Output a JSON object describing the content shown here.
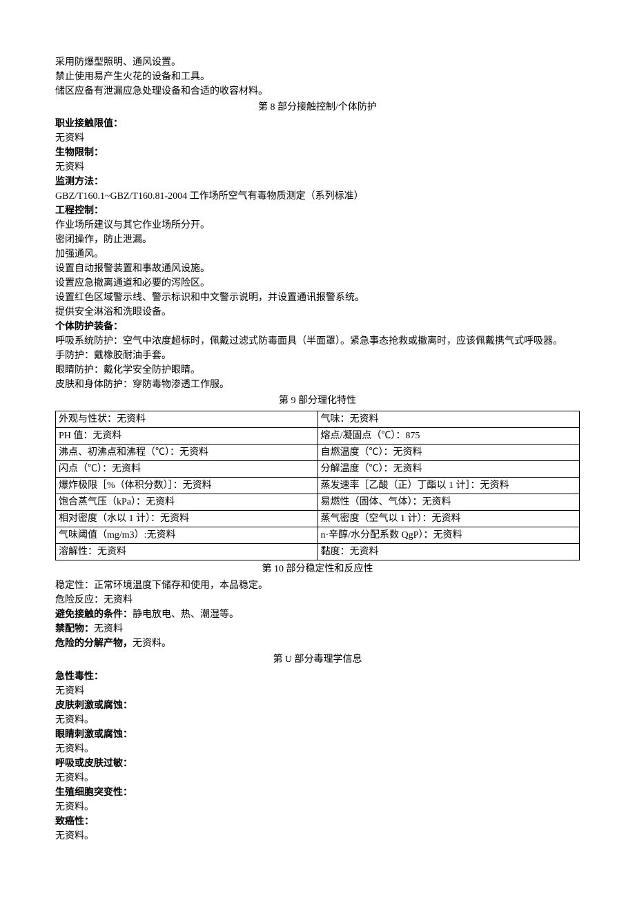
{
  "intro": {
    "line1": "采用防爆型照明、通风设置。",
    "line2": "禁止使用易产生火花的设备和工具。",
    "line3": "储区应备有泄漏应急处理设备和合适的收容材料。"
  },
  "section8": {
    "title": "第 8 部分接触控制/个体防护",
    "occupational_exposure_label": "职业接触限值：",
    "occupational_exposure_value": "无资料",
    "biological_limit_label": "生物限制：",
    "biological_limit_value": "无资料",
    "monitoring_method_label": "监测方法：",
    "monitoring_method_value": "GBZ/T160.1~GBZ/T160.81-2004 工作场所空气有毒物质测定（系列标准）",
    "engineering_control_label": "工程控制：",
    "engineering_controls": {
      "l1": "作业场所建议与其它作业场所分开。",
      "l2": "密闭操作，防止泄漏。",
      "l3": "加强通风。",
      "l4": "设置自动报警装置和事故通风设施。",
      "l5": "设置应急撤离通道和必要的泻险区。",
      "l6": "设置红色区域警示线、警示标识和中文警示说明，并设置通讯报警系统。",
      "l7": "提供安全淋浴和洗眼设备。"
    },
    "ppe_label": "个体防护装备：",
    "ppe_respiratory": "呼吸系统防护：空气中浓度超标时，佩戴过滤式防毒面具（半面罩）。紧急事态抢救或撤离时，应该佩戴携气式呼吸器。",
    "ppe_hand": "手防护：戴橡胶耐油手套。",
    "ppe_eye": "眼睛防护：戴化学安全防护眼睛。",
    "ppe_skin": "皮肤和身体防护：穿防毒物渗透工作服。"
  },
  "section9": {
    "title": "第 9 部分理化特性",
    "rows": [
      {
        "left": "外观与性状：无资料",
        "right": "气味：无资料"
      },
      {
        "left": "PH 值：无资料",
        "right": "熔点/凝固点（℃）：875"
      },
      {
        "left": "沸点、初沸点和沸程（℃）：无资料",
        "right": "自燃温度（℃）：无资料"
      },
      {
        "left": "闪点（℃）：无资料",
        "right": "分解温度（℃）：无资料"
      },
      {
        "left": "爆炸极限［%（体积分数）］：无资料",
        "right": "蒸发速率［乙酸（正）丁酯以 1 计］：无资料"
      },
      {
        "left": "饱合蒸气压（kPa）：无资料",
        "right": "易燃性（固体、气体）：无资料"
      },
      {
        "left": "相对密度（水以 1 计）：无资料",
        "right": "蒸气密度（空气以 1 计）：无资料"
      },
      {
        "left": "气味阈值（mg/m3）:无资料",
        "right": "n·辛醇/水分配系数 QgP）：无资料"
      },
      {
        "left": "溶解性：无资料",
        "right": "黏度：无资料"
      }
    ]
  },
  "section10": {
    "title": "第 10 部分稳定性和反应性",
    "stability": "稳定性：正常环境温度下储存和使用，本品稳定。",
    "hazard_reaction": "危险反应：无资料",
    "avoid_label": "避免接触的条件：",
    "avoid_value": "静电放电、热、潮湿等。",
    "incompatible_label": "禁配物：",
    "incompatible_value": "无资料",
    "decomp_label": "危险的分解产物，",
    "decomp_value": "无资料。"
  },
  "section11": {
    "title": "第 U 部分毒理学信息",
    "acute_label": "急性毒性：",
    "acute_value": "无资料",
    "skin_label": "皮肤刺激或腐蚀：",
    "skin_value": "无资料。",
    "eye_label": "眼睛刺激或腐蚀：",
    "eye_value": "无资料。",
    "resp_label": "呼吸或皮肤过敏：",
    "resp_value": "无资料。",
    "germ_label": "生殖细胞突变性：",
    "germ_value": "无资料。",
    "carcinogen_label": "致癌性：",
    "carcinogen_value": "无资料。"
  }
}
